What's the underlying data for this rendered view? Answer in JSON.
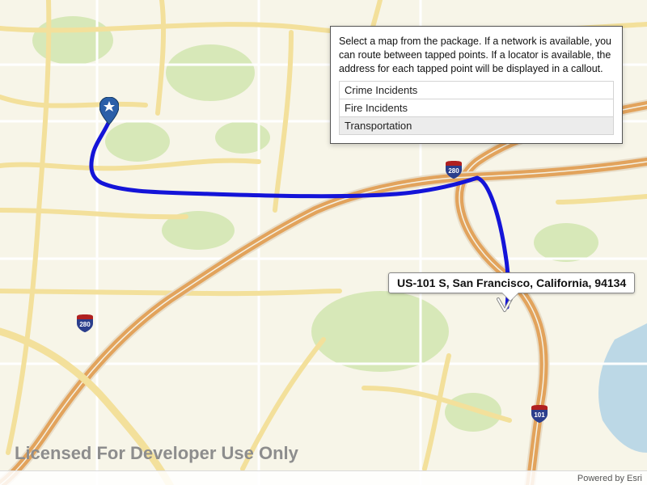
{
  "panel": {
    "description": "Select a map from the package. If a network is available, you can route between tapped points. If a locator is available, the address for each tapped point will be displayed in a callout.",
    "items": [
      "Crime Incidents",
      "Fire Incidents",
      "Transportation"
    ],
    "selected_index": 2
  },
  "callout": {
    "text": "US-101 S, San Francisco, California, 94134"
  },
  "highway_shields": {
    "top": "280",
    "left": "280",
    "bottom": "101"
  },
  "watermark": "Licensed For Developer Use Only",
  "attribution": "Powered by Esri",
  "colors": {
    "interstate_blue": "#2b3e8c",
    "interstate_red": "#b02020",
    "route_blue": "#1414d8",
    "highway_orange": "#e2a35c",
    "road_yellow": "#f3e09b",
    "park_green": "#d7e8b8",
    "water_blue": "#bcd8e6",
    "land": "#f7f5e8"
  }
}
